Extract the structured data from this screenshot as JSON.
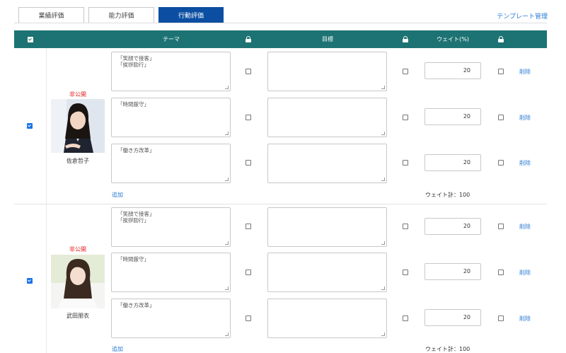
{
  "tabs": [
    "業績評価",
    "能力評価",
    "行動評価"
  ],
  "template_link": "テンプレート管理",
  "header": {
    "theme": "テーマ",
    "goal": "目標",
    "weight": "ウェイト(%)"
  },
  "rows": [
    {
      "selected": true,
      "status": "非公開",
      "name": "佐倉哲子",
      "items": [
        {
          "theme": "「笑顔で接客」\n「挨拶励行」",
          "goal": "",
          "weight": "20",
          "delete": "削除"
        },
        {
          "theme": "「時間厳守」",
          "goal": "",
          "weight": "20",
          "delete": "削除"
        },
        {
          "theme": "「働き方改革」",
          "goal": "",
          "weight": "20",
          "delete": "削除"
        }
      ],
      "add": "追加",
      "weight_total_label": "ウェイト計：",
      "weight_total": "100"
    },
    {
      "selected": true,
      "status": "非公開",
      "name": "武田朋衣",
      "items": [
        {
          "theme": "「笑顔で接客」\n「挨拶励行」",
          "goal": "",
          "weight": "20",
          "delete": "削除"
        },
        {
          "theme": "「時間厳守」",
          "goal": "",
          "weight": "20",
          "delete": "削除"
        },
        {
          "theme": "「働き方改革」",
          "goal": "",
          "weight": "20",
          "delete": "削除"
        }
      ],
      "add": "追加",
      "weight_total_label": "ウェイト計：",
      "weight_total": "100"
    }
  ],
  "colors": {
    "header_bg": "#1d7373",
    "active_tab": "#0b4ea2",
    "link": "#2a7bd4",
    "status": "#e02020"
  }
}
